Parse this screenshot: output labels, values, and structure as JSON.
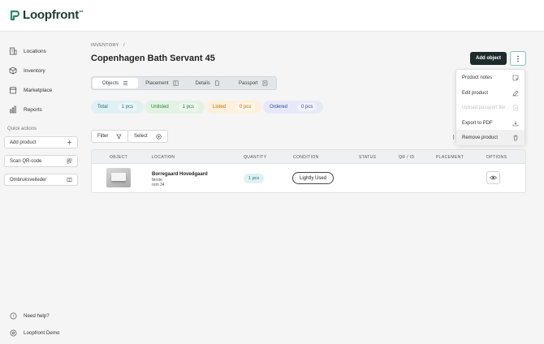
{
  "app": {
    "logo_text": "Loopfront",
    "logo_tm": "™"
  },
  "sidebar": {
    "items": [
      {
        "label": "Locations",
        "icon": "building-icon"
      },
      {
        "label": "Inventory",
        "icon": "cube-icon"
      },
      {
        "label": "Marketplace",
        "icon": "store-icon"
      },
      {
        "label": "Reports",
        "icon": "bar-chart-icon"
      }
    ],
    "quick_actions_title": "Quick actions",
    "quick_actions": [
      {
        "label": "Add product",
        "icon": "plus-icon"
      },
      {
        "label": "Scan QR-code",
        "icon": "qr-icon"
      },
      {
        "label": "Ombruksveileder",
        "icon": "book-icon"
      }
    ],
    "footer": [
      {
        "label": "Need help?",
        "icon": "help-icon"
      },
      {
        "label": "Loopfront Demo",
        "icon": "settings-icon"
      }
    ]
  },
  "header": {
    "breadcrumb": "INVENTORY",
    "breadcrumb_sep": "/",
    "title": "Copenhagen Bath Servant 45",
    "add_object_label": "Add object"
  },
  "tabs": [
    {
      "label": "Objects",
      "active": true
    },
    {
      "label": "Placement",
      "active": false
    },
    {
      "label": "Details",
      "active": false
    },
    {
      "label": "Passport",
      "active": false
    }
  ],
  "stats": {
    "total": {
      "label": "Total",
      "value": "1 pcs"
    },
    "unlisted": {
      "label": "Unlisted",
      "value": "1 pcs"
    },
    "listed": {
      "label": "Listed",
      "value": "0 pcs"
    },
    "ordered": {
      "label": "Ordered",
      "value": "0 pcs"
    }
  },
  "toolbar": {
    "filter_label": "Filter",
    "select_label": "Select"
  },
  "table": {
    "columns": [
      "OBJECT",
      "LOCATION",
      "QUANTITY",
      "CONDITION",
      "STATUS",
      "QR / ID",
      "PLACEMENT",
      "OPTIONS"
    ],
    "rows": [
      {
        "location_name": "Borregaard Hovedgaard",
        "location_floor": "første",
        "location_room": "rom 34",
        "quantity": "1 pcs",
        "condition": "Lightly Used"
      }
    ]
  },
  "menu": {
    "items": [
      {
        "label": "Product notes",
        "icon": "note-icon",
        "disabled": false
      },
      {
        "label": "Edit product",
        "icon": "edit-icon",
        "disabled": false
      },
      {
        "label": "Upload passport file",
        "icon": "file-upload-icon",
        "disabled": true
      },
      {
        "label": "Export to PDF",
        "icon": "download-icon",
        "disabled": false
      },
      {
        "label": "Remove product",
        "icon": "trash-icon",
        "disabled": false
      }
    ]
  },
  "colors": {
    "primary_dark": "#1c2b2c",
    "accent_teal": "#7fc7b6",
    "total": "#1d6e7a",
    "unlisted": "#2e7d32",
    "listed": "#c26b00",
    "ordered": "#3b4a9a"
  }
}
